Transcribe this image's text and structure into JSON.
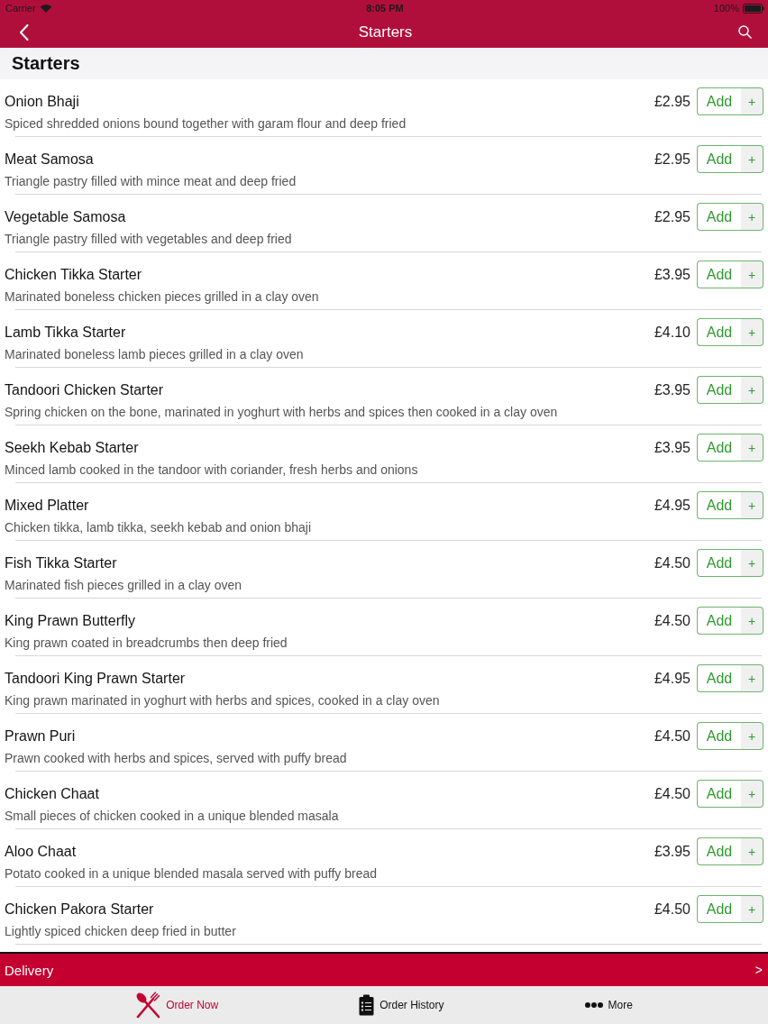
{
  "status_bar": {
    "carrier": "Carrier",
    "time": "8:05 PM",
    "battery": "100%"
  },
  "nav_bar": {
    "title": "Starters"
  },
  "section": {
    "title": "Starters"
  },
  "items": [
    {
      "name": "Onion Bhaji",
      "description": "Spiced shredded onions bound together with garam flour and deep fried",
      "price": "£2.95",
      "add_label": "Add",
      "plus_label": "+"
    },
    {
      "name": "Meat Samosa",
      "description": "Triangle pastry filled with mince meat and deep fried",
      "price": "£2.95",
      "add_label": "Add",
      "plus_label": "+"
    },
    {
      "name": "Vegetable Samosa",
      "description": "Triangle pastry filled with vegetables and deep fried",
      "price": "£2.95",
      "add_label": "Add",
      "plus_label": "+"
    },
    {
      "name": "Chicken Tikka Starter",
      "description": "Marinated boneless chicken pieces grilled in a clay oven",
      "price": "£3.95",
      "add_label": "Add",
      "plus_label": "+"
    },
    {
      "name": "Lamb Tikka Starter",
      "description": "Marinated boneless lamb pieces grilled in a clay oven",
      "price": "£4.10",
      "add_label": "Add",
      "plus_label": "+"
    },
    {
      "name": "Tandoori Chicken Starter",
      "description": "Spring chicken on the bone, marinated in yoghurt with herbs and spices then cooked in a clay oven",
      "price": "£3.95",
      "add_label": "Add",
      "plus_label": "+"
    },
    {
      "name": "Seekh Kebab Starter",
      "description": "Minced lamb cooked in the tandoor with coriander, fresh herbs and onions",
      "price": "£3.95",
      "add_label": "Add",
      "plus_label": "+"
    },
    {
      "name": "Mixed Platter",
      "description": "Chicken tikka, lamb tikka, seekh kebab and onion bhaji",
      "price": "£4.95",
      "add_label": "Add",
      "plus_label": "+"
    },
    {
      "name": "Fish Tikka Starter",
      "description": "Marinated fish pieces grilled in a clay oven",
      "price": "£4.50",
      "add_label": "Add",
      "plus_label": "+"
    },
    {
      "name": "King Prawn Butterfly",
      "description": "King prawn coated in breadcrumbs then deep fried",
      "price": "£4.50",
      "add_label": "Add",
      "plus_label": "+"
    },
    {
      "name": "Tandoori King Prawn Starter",
      "description": "King prawn marinated in yoghurt with herbs and spices, cooked in a clay oven",
      "price": "£4.95",
      "add_label": "Add",
      "plus_label": "+"
    },
    {
      "name": "Prawn Puri",
      "description": "Prawn cooked with herbs and spices, served with puffy bread",
      "price": "£4.50",
      "add_label": "Add",
      "plus_label": "+"
    },
    {
      "name": "Chicken Chaat",
      "description": "Small pieces of chicken cooked in a unique blended masala",
      "price": "£4.50",
      "add_label": "Add",
      "plus_label": "+"
    },
    {
      "name": "Aloo Chaat",
      "description": "Potato cooked in a unique blended masala served with puffy bread",
      "price": "£3.95",
      "add_label": "Add",
      "plus_label": "+"
    },
    {
      "name": "Chicken Pakora Starter",
      "description": "Lightly spiced chicken deep fried in butter",
      "price": "£4.50",
      "add_label": "Add",
      "plus_label": "+"
    }
  ],
  "delivery_bar": {
    "label": "Delivery",
    "arrow": ">"
  },
  "tab_bar": {
    "tabs": [
      {
        "label": "Order Now",
        "selected": true
      },
      {
        "label": "Order History",
        "selected": false
      },
      {
        "label": "More",
        "selected": false
      }
    ]
  }
}
